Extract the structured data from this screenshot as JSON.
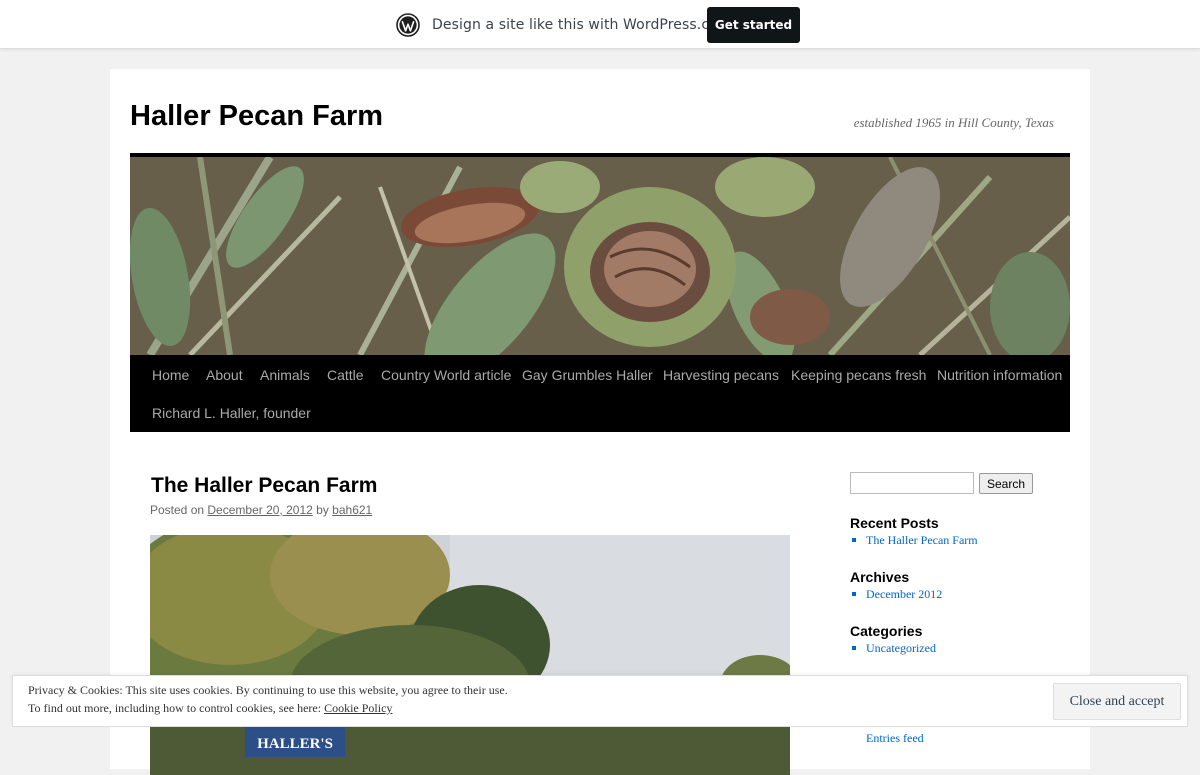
{
  "wp_bar": {
    "text": "Design a site like this with WordPress.com",
    "cta": "Get started",
    "logo_icon": "wordpress-logo-icon"
  },
  "site": {
    "title": "Haller Pecan Farm",
    "description": "established 1965 in Hill County, Texas"
  },
  "nav": {
    "items": [
      "Home",
      "About",
      "Animals",
      "Cattle",
      "Country World article",
      "Gay Grumbles Haller",
      "Harvesting pecans",
      "Keeping pecans fresh",
      "Nutrition information",
      "Richard L. Haller, founder"
    ]
  },
  "post": {
    "title": "The Haller Pecan Farm",
    "posted_on_label": "Posted on",
    "date": "December 20, 2012",
    "by_label": "by",
    "author": "bah621",
    "sign_text": "HALLER'S"
  },
  "sidebar": {
    "search_button": "Search",
    "search_value": "",
    "recent_posts": {
      "title": "Recent Posts",
      "items": [
        "The Haller Pecan Farm"
      ]
    },
    "archives": {
      "title": "Archives",
      "items": [
        "December 2012"
      ]
    },
    "categories": {
      "title": "Categories",
      "items": [
        "Uncategorized"
      ]
    },
    "meta_partial": "Entries feed"
  },
  "cookie": {
    "line1": "Privacy & Cookies: This site uses cookies. By continuing to use this website, you agree to their use.",
    "line2_prefix": "To find out more, including how to control cookies, see here:",
    "policy_link": "Cookie Policy",
    "button": "Close and accept"
  },
  "colors": {
    "page_bg": "#f1f1f1",
    "nav_bg": "#000000",
    "nav_text": "#aaaaaa",
    "link": "#0066cc",
    "cta_bg": "#101517"
  }
}
